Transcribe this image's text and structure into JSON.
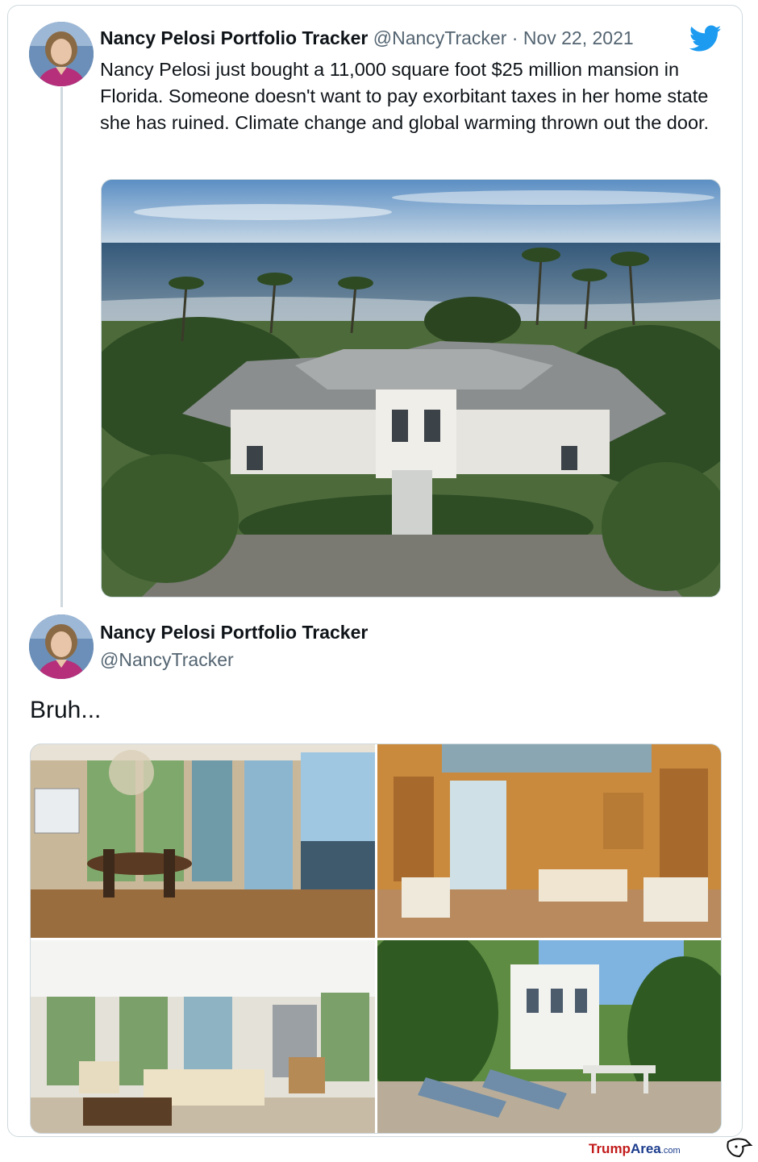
{
  "tweet1": {
    "author_name": "Nancy Pelosi Portfolio Tracker",
    "handle": "@NancyTracker",
    "separator": "·",
    "date": "Nov 22, 2021",
    "text": "Nancy Pelosi just bought a 11,000 square foot $25 million mansion in Florida. Someone doesn't want to pay exorbitant taxes in her home state she has ruined. Climate change and global warming thrown out the door.",
    "photo": "aerial-view-of-oceanfront-mansion"
  },
  "tweet2": {
    "author_name": "Nancy Pelosi Portfolio Tracker",
    "handle": "@NancyTracker",
    "text": "Bruh...",
    "photos": [
      "dining-room",
      "library",
      "living-room",
      "pool-patio"
    ]
  },
  "icons": {
    "platform": "twitter-bird-icon"
  },
  "colors": {
    "twitter_blue": "#1d9bf0",
    "border": "#cfd9de",
    "secondary_text": "#536471"
  },
  "watermark": {
    "part1": "Trump",
    "part2": "Area",
    "part3": ".com"
  }
}
